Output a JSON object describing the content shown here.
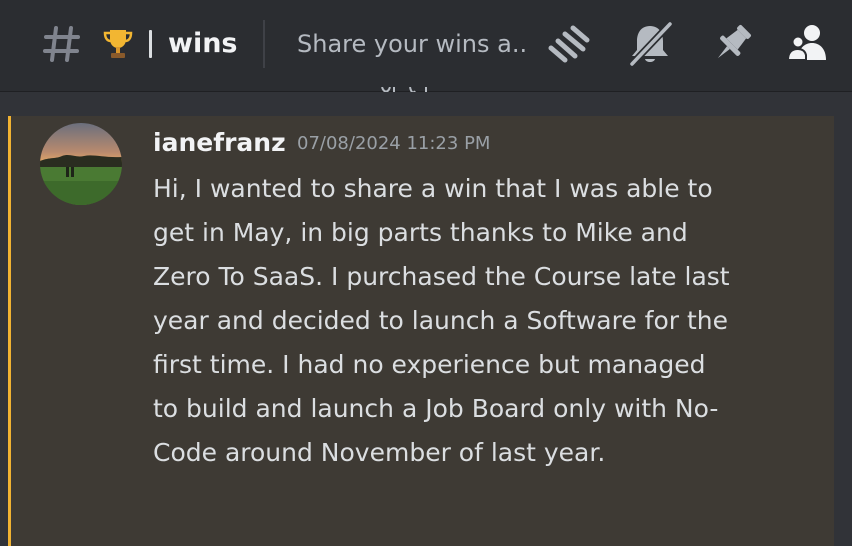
{
  "header": {
    "channel_emoji": "🏆",
    "channel_name": "wins",
    "topic": "Share your wins a...",
    "icons": [
      "hash-icon",
      "threads-icon",
      "muted-bell-icon",
      "pin-icon",
      "member-list-icon"
    ]
  },
  "message": {
    "username": "ianefranz",
    "timestamp": "07/08/2024 11:23 PM",
    "content": "Hi, I wanted to share a win that I was able to get in May, in big parts thanks to Mike and Zero To SaaS. I purchased the Course late last year and decided to launch a Software for the first time. I had no experience but managed to build and launch a Job Board only with No-Code around November of last year.",
    "highlight_color": "#f0b232"
  },
  "colors": {
    "header_bg": "#2b2d31",
    "message_bg": "#3e3a34",
    "text": "#dbdee1",
    "muted": "#b5bac1"
  }
}
